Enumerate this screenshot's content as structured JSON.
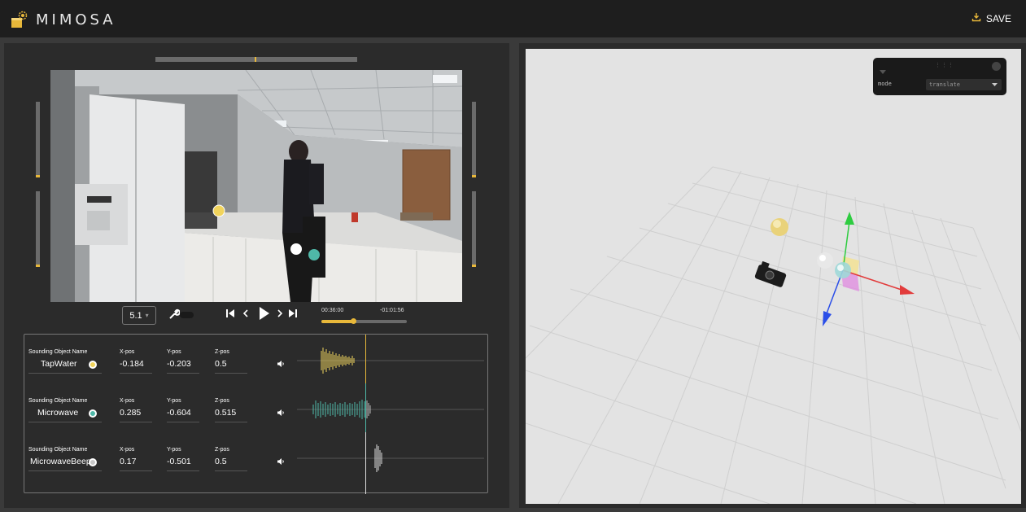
{
  "app": {
    "name": "MIMOSA"
  },
  "header": {
    "save_label": "SAVE"
  },
  "playback": {
    "speed": "5.1",
    "current_time": "00:36:00",
    "remaining_time": "-01:01:56",
    "progress_fraction": 0.37
  },
  "objects": {
    "column_labels": {
      "name": "Sounding Object Name",
      "x": "X-pos",
      "y": "Y-pos",
      "z": "Z-pos"
    },
    "items": [
      {
        "name": "TapWater",
        "x": "-0.184",
        "y": "-0.203",
        "z": "0.5",
        "color": "#f1d45c"
      },
      {
        "name": "Microwave",
        "x": "0.285",
        "y": "-0.604",
        "z": "0.515",
        "color": "#4fb8a8"
      },
      {
        "name": "MicrowaveBeep",
        "x": "0.17",
        "y": "-0.501",
        "z": "0.5",
        "color": "#c8c8c8"
      }
    ]
  },
  "viewport": {
    "gui": {
      "mode_label": "mode",
      "mode_value": "translate"
    }
  },
  "colors": {
    "accent": "#e8b83a",
    "header_bg": "#1e1e1e",
    "panel_bg": "#2b2b2b"
  }
}
